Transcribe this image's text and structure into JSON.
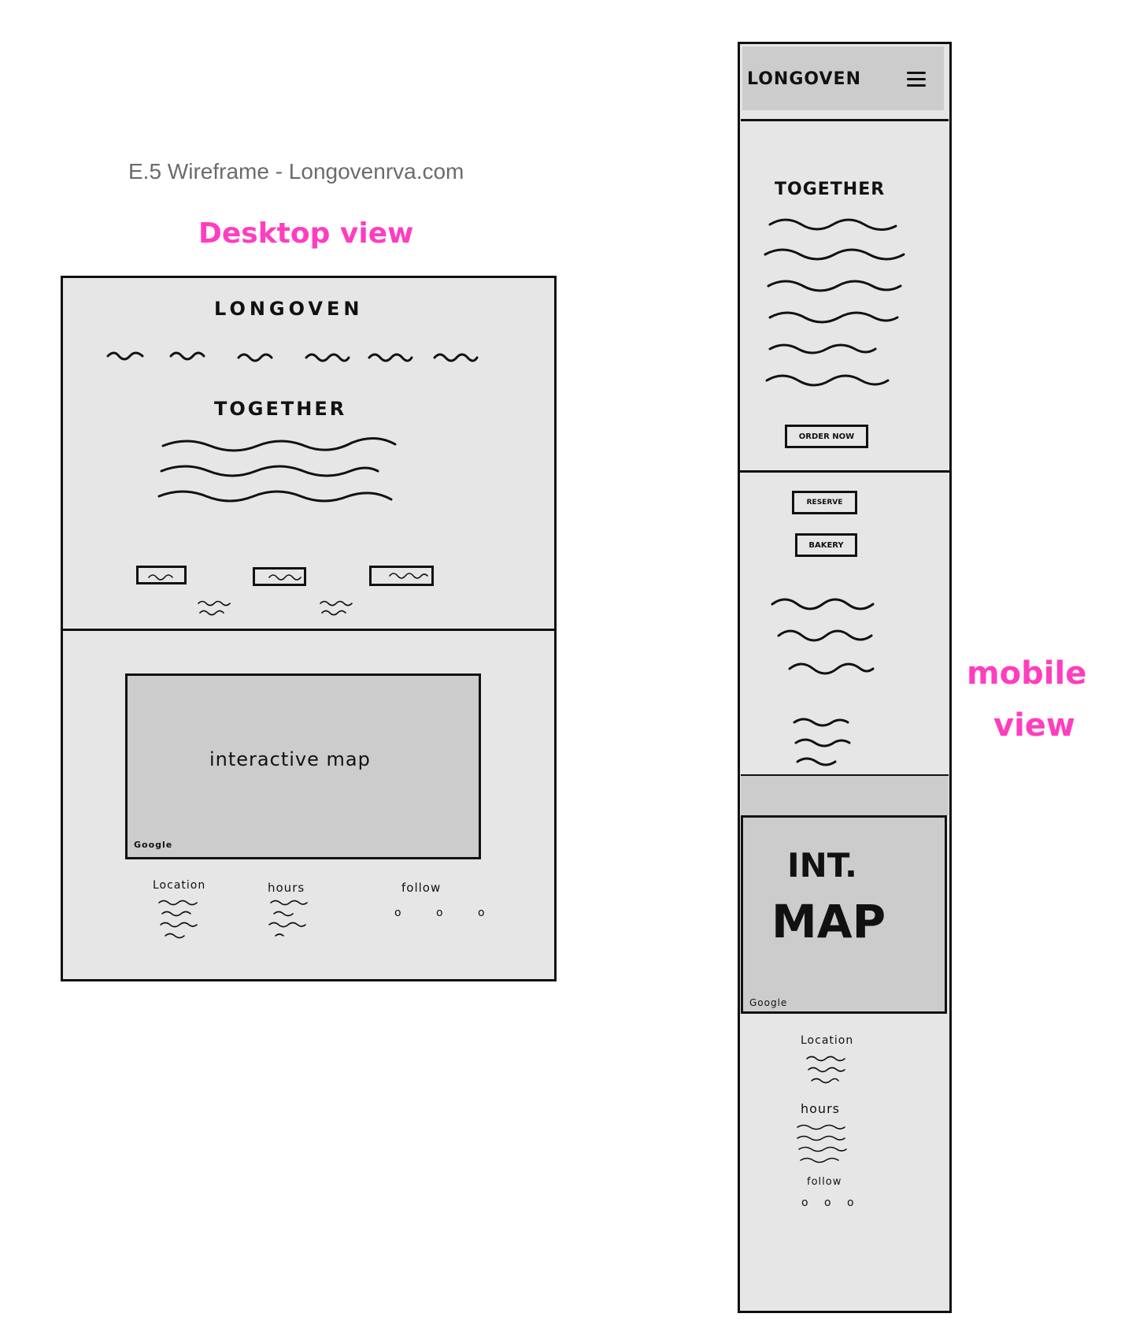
{
  "caption": "E.5 Wireframe - Longovenrva.com",
  "labels": {
    "desktop": "Desktop view",
    "mobile_1": "mobile",
    "mobile_2": "view"
  },
  "colors": {
    "annotation": "#ff3dbf",
    "frame_fill": "#e6e6e6",
    "map_fill": "#cccccc",
    "ink": "#111111"
  },
  "desktop": {
    "brand": "LONGOVEN",
    "headline": "TOGETHER",
    "map_label": "interactive map",
    "map_attribution": "Google",
    "footer": {
      "location": "Location",
      "hours": "hours",
      "follow": "follow",
      "social_icons": "o o o"
    }
  },
  "mobile": {
    "brand": "LONGOVEN",
    "menu_icon": "hamburger-icon",
    "headline": "TOGETHER",
    "order_button": "ORDER NOW",
    "reserve_button": "RESERVE",
    "bakery_button": "BAKERY",
    "map_label_1": "INT.",
    "map_label_2": "MAP",
    "map_attribution": "Google",
    "footer": {
      "location": "Location",
      "hours": "hours",
      "follow": "follow",
      "social_icons": "o o o"
    }
  }
}
